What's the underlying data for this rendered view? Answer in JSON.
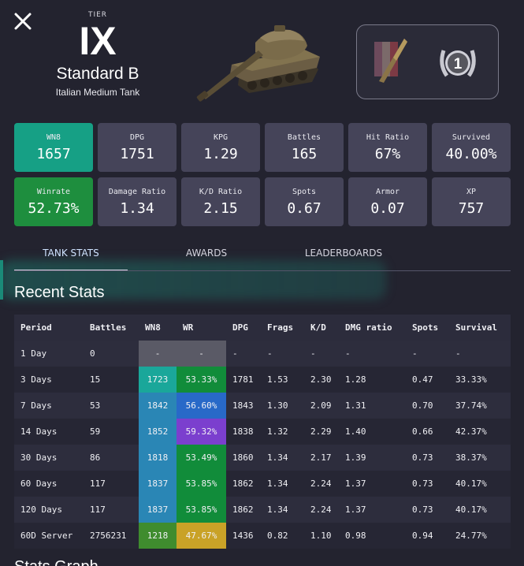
{
  "header": {
    "tier_label": "TIER",
    "tier": "IX",
    "tank_name": "Standard B",
    "tank_type": "Italian Medium Tank"
  },
  "badges": {
    "mastery_level": "1"
  },
  "stats": [
    {
      "label": "WN8",
      "value": "1657",
      "color": "#16a085"
    },
    {
      "label": "DPG",
      "value": "1751"
    },
    {
      "label": "KPG",
      "value": "1.29"
    },
    {
      "label": "Battles",
      "value": "165"
    },
    {
      "label": "Hit Ratio",
      "value": "67%"
    },
    {
      "label": "Survived",
      "value": "40.00%"
    },
    {
      "label": "Winrate",
      "value": "52.73%",
      "color": "#1e8e3e"
    },
    {
      "label": "Damage Ratio",
      "value": "1.34"
    },
    {
      "label": "K/D Ratio",
      "value": "2.15"
    },
    {
      "label": "Spots",
      "value": "0.67"
    },
    {
      "label": "Armor",
      "value": "0.07"
    },
    {
      "label": "XP",
      "value": "757"
    }
  ],
  "tabs": [
    {
      "label": "TANK STATS",
      "active": true
    },
    {
      "label": "AWARDS",
      "active": false
    },
    {
      "label": "LEADERBOARDS",
      "active": false
    }
  ],
  "recent_stats": {
    "title": "Recent Stats",
    "columns": [
      "Period",
      "Battles",
      "WN8",
      "WR",
      "DPG",
      "Frags",
      "K/D",
      "DMG ratio",
      "Spots",
      "Survival"
    ],
    "rows": [
      {
        "period": "1 Day",
        "battles": "0",
        "wn8": "-",
        "wr": "-",
        "dpg": "-",
        "frags": "-",
        "kd": "-",
        "dmg_ratio": "-",
        "spots": "-",
        "survival": "-",
        "wn8_color": "#5a5a66",
        "wr_color": "#5a5a66"
      },
      {
        "period": "3 Days",
        "battles": "15",
        "wn8": "1723",
        "wr": "53.33%",
        "dpg": "1781",
        "frags": "1.53",
        "kd": "2.30",
        "dmg_ratio": "1.28",
        "spots": "0.47",
        "survival": "33.33%",
        "wn8_color": "#1aa79a",
        "wr_color": "#118c3a"
      },
      {
        "period": "7 Days",
        "battles": "53",
        "wn8": "1842",
        "wr": "56.60%",
        "dpg": "1843",
        "frags": "1.30",
        "kd": "2.09",
        "dmg_ratio": "1.31",
        "spots": "0.70",
        "survival": "37.74%",
        "wn8_color": "#2a86b5",
        "wr_color": "#2869c8"
      },
      {
        "period": "14 Days",
        "battles": "59",
        "wn8": "1852",
        "wr": "59.32%",
        "dpg": "1838",
        "frags": "1.32",
        "kd": "2.29",
        "dmg_ratio": "1.40",
        "spots": "0.66",
        "survival": "42.37%",
        "wn8_color": "#2a86b5",
        "wr_color": "#7b3fce"
      },
      {
        "period": "30 Days",
        "battles": "86",
        "wn8": "1818",
        "wr": "53.49%",
        "dpg": "1860",
        "frags": "1.34",
        "kd": "2.17",
        "dmg_ratio": "1.39",
        "spots": "0.73",
        "survival": "38.37%",
        "wn8_color": "#2a86b5",
        "wr_color": "#118c3a"
      },
      {
        "period": "60 Days",
        "battles": "117",
        "wn8": "1837",
        "wr": "53.85%",
        "dpg": "1862",
        "frags": "1.34",
        "kd": "2.24",
        "dmg_ratio": "1.37",
        "spots": "0.73",
        "survival": "40.17%",
        "wn8_color": "#2a86b5",
        "wr_color": "#118c3a"
      },
      {
        "period": "120 Days",
        "battles": "117",
        "wn8": "1837",
        "wr": "53.85%",
        "dpg": "1862",
        "frags": "1.34",
        "kd": "2.24",
        "dmg_ratio": "1.37",
        "spots": "0.73",
        "survival": "40.17%",
        "wn8_color": "#2a86b5",
        "wr_color": "#118c3a"
      },
      {
        "period": "60D Server",
        "battles": "2756231",
        "wn8": "1218",
        "wr": "47.67%",
        "dpg": "1436",
        "frags": "0.82",
        "kd": "1.10",
        "dmg_ratio": "0.98",
        "spots": "0.94",
        "survival": "24.77%",
        "wn8_color": "#3f8c2e",
        "wr_color": "#c9a227"
      }
    ]
  },
  "next_section": {
    "title": "Stats Graph"
  }
}
